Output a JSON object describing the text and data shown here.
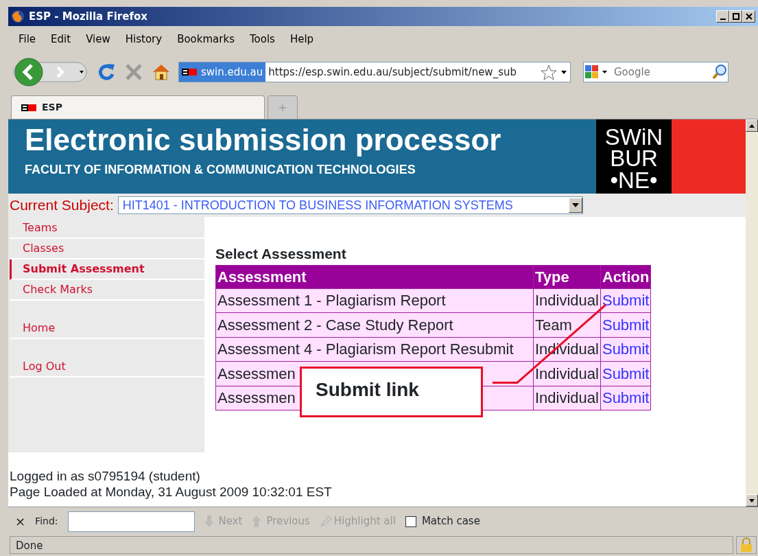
{
  "window": {
    "title": "ESP - Mozilla Firefox"
  },
  "menu": [
    "File",
    "Edit",
    "View",
    "History",
    "Bookmarks",
    "Tools",
    "Help"
  ],
  "toolbar": {
    "site_label": "swin.edu.au",
    "url": "https://esp.swin.edu.au/subject/submit/new_sub",
    "search": {
      "placeholder": "Google"
    }
  },
  "tabs": [
    {
      "label": "ESP",
      "selected": true
    }
  ],
  "page": {
    "banner": {
      "title": "Electronic submission processor",
      "subtitle": "FACULTY OF INFORMATION & COMMUNICATION TECHNOLOGIES",
      "logo_lines": [
        "SWiN",
        "BUR",
        "•NE•"
      ]
    },
    "subject": {
      "label": "Current Subject:",
      "value": "HIT1401 - INTRODUCTION TO BUSINESS INFORMATION SYSTEMS"
    },
    "sidebar": {
      "groups": [
        [
          {
            "label": "Teams",
            "selected": false
          },
          {
            "label": "Classes",
            "selected": false
          },
          {
            "label": "Submit Assessment",
            "selected": true
          },
          {
            "label": "Check Marks",
            "selected": false
          }
        ],
        [
          {
            "label": "Home",
            "selected": false
          }
        ],
        [
          {
            "label": "Log Out",
            "selected": false
          }
        ]
      ]
    },
    "table": {
      "heading": "Select Assessment",
      "columns": [
        "Assessment",
        "Type",
        "Action"
      ],
      "rows": [
        {
          "assessment": "Assessment 1 - Plagiarism Report",
          "type": "Individual",
          "action": "Submit"
        },
        {
          "assessment": "Assessment 2 - Case Study Report",
          "type": "Team",
          "action": "Submit"
        },
        {
          "assessment": "Assessment 4 - Plagiarism Report Resubmit",
          "type": "Individual",
          "action": "Submit"
        },
        {
          "assessment": "Assessmen",
          "type": "Individual",
          "action": "Submit"
        },
        {
          "assessment": "Assessmen",
          "type": "Individual",
          "action": "Submit"
        }
      ]
    },
    "callout": {
      "text": "Submit link"
    },
    "footer": [
      "Logged in as s0795194 (student)",
      "Page Loaded at Monday, 31 August 2009 10:32:01 EST"
    ]
  },
  "find_bar": {
    "close": "×",
    "label": "Find:",
    "buttons": [
      {
        "label": "Next",
        "disabled": true
      },
      {
        "label": "Previous",
        "disabled": true
      },
      {
        "label": "Highlight all",
        "disabled": true
      }
    ],
    "match_case": {
      "label": "Match case",
      "checked": false
    }
  },
  "status_bar": {
    "text": "Done"
  }
}
